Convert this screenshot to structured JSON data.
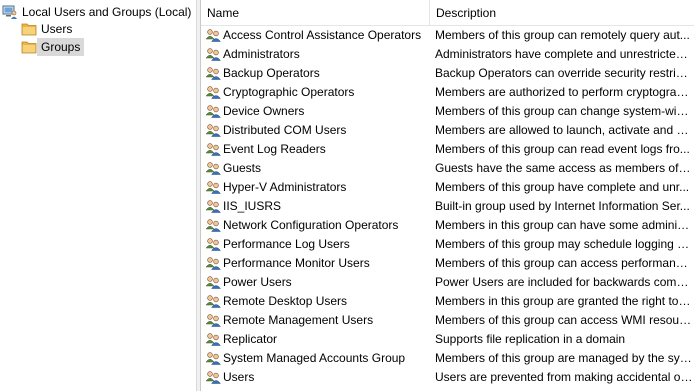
{
  "tree": {
    "root": {
      "label": "Local Users and Groups (Local)",
      "icon": "computer-users-icon"
    },
    "children": [
      {
        "label": "Users",
        "icon": "folder-icon",
        "selected": false
      },
      {
        "label": "Groups",
        "icon": "folder-icon",
        "selected": true
      }
    ]
  },
  "list": {
    "columns": {
      "name": "Name",
      "description": "Description"
    },
    "row_icon": "group-icon",
    "rows": [
      {
        "name": "Access Control Assistance Operators",
        "description": "Members of this group can remotely query aut..."
      },
      {
        "name": "Administrators",
        "description": "Administrators have complete and unrestricted ..."
      },
      {
        "name": "Backup Operators",
        "description": "Backup Operators can override security restricti..."
      },
      {
        "name": "Cryptographic Operators",
        "description": "Members are authorized to perform cryptograp..."
      },
      {
        "name": "Device Owners",
        "description": "Members of this group can change system-wid..."
      },
      {
        "name": "Distributed COM Users",
        "description": "Members are allowed to launch, activate and us..."
      },
      {
        "name": "Event Log Readers",
        "description": "Members of this group can read event logs fro..."
      },
      {
        "name": "Guests",
        "description": "Guests have the same access as members of th..."
      },
      {
        "name": "Hyper-V Administrators",
        "description": "Members of this group have complete and unr..."
      },
      {
        "name": "IIS_IUSRS",
        "description": "Built-in group used by Internet Information Ser..."
      },
      {
        "name": "Network Configuration Operators",
        "description": "Members in this group can have some administ..."
      },
      {
        "name": "Performance Log Users",
        "description": "Members of this group may schedule logging o..."
      },
      {
        "name": "Performance Monitor Users",
        "description": "Members of this group can access performance..."
      },
      {
        "name": "Power Users",
        "description": "Power Users are included for backwards compa..."
      },
      {
        "name": "Remote Desktop Users",
        "description": "Members in this group are granted the right to l..."
      },
      {
        "name": "Remote Management Users",
        "description": "Members of this group can access WMI resourc..."
      },
      {
        "name": "Replicator",
        "description": "Supports file replication in a domain"
      },
      {
        "name": "System Managed Accounts Group",
        "description": "Members of this group are managed by the sys..."
      },
      {
        "name": "Users",
        "description": "Users are prevented from making accidental or ..."
      }
    ]
  },
  "colors": {
    "selection": "#d9d9d9",
    "folder": "#f2c867",
    "header_divider": "#e5e5e5"
  }
}
